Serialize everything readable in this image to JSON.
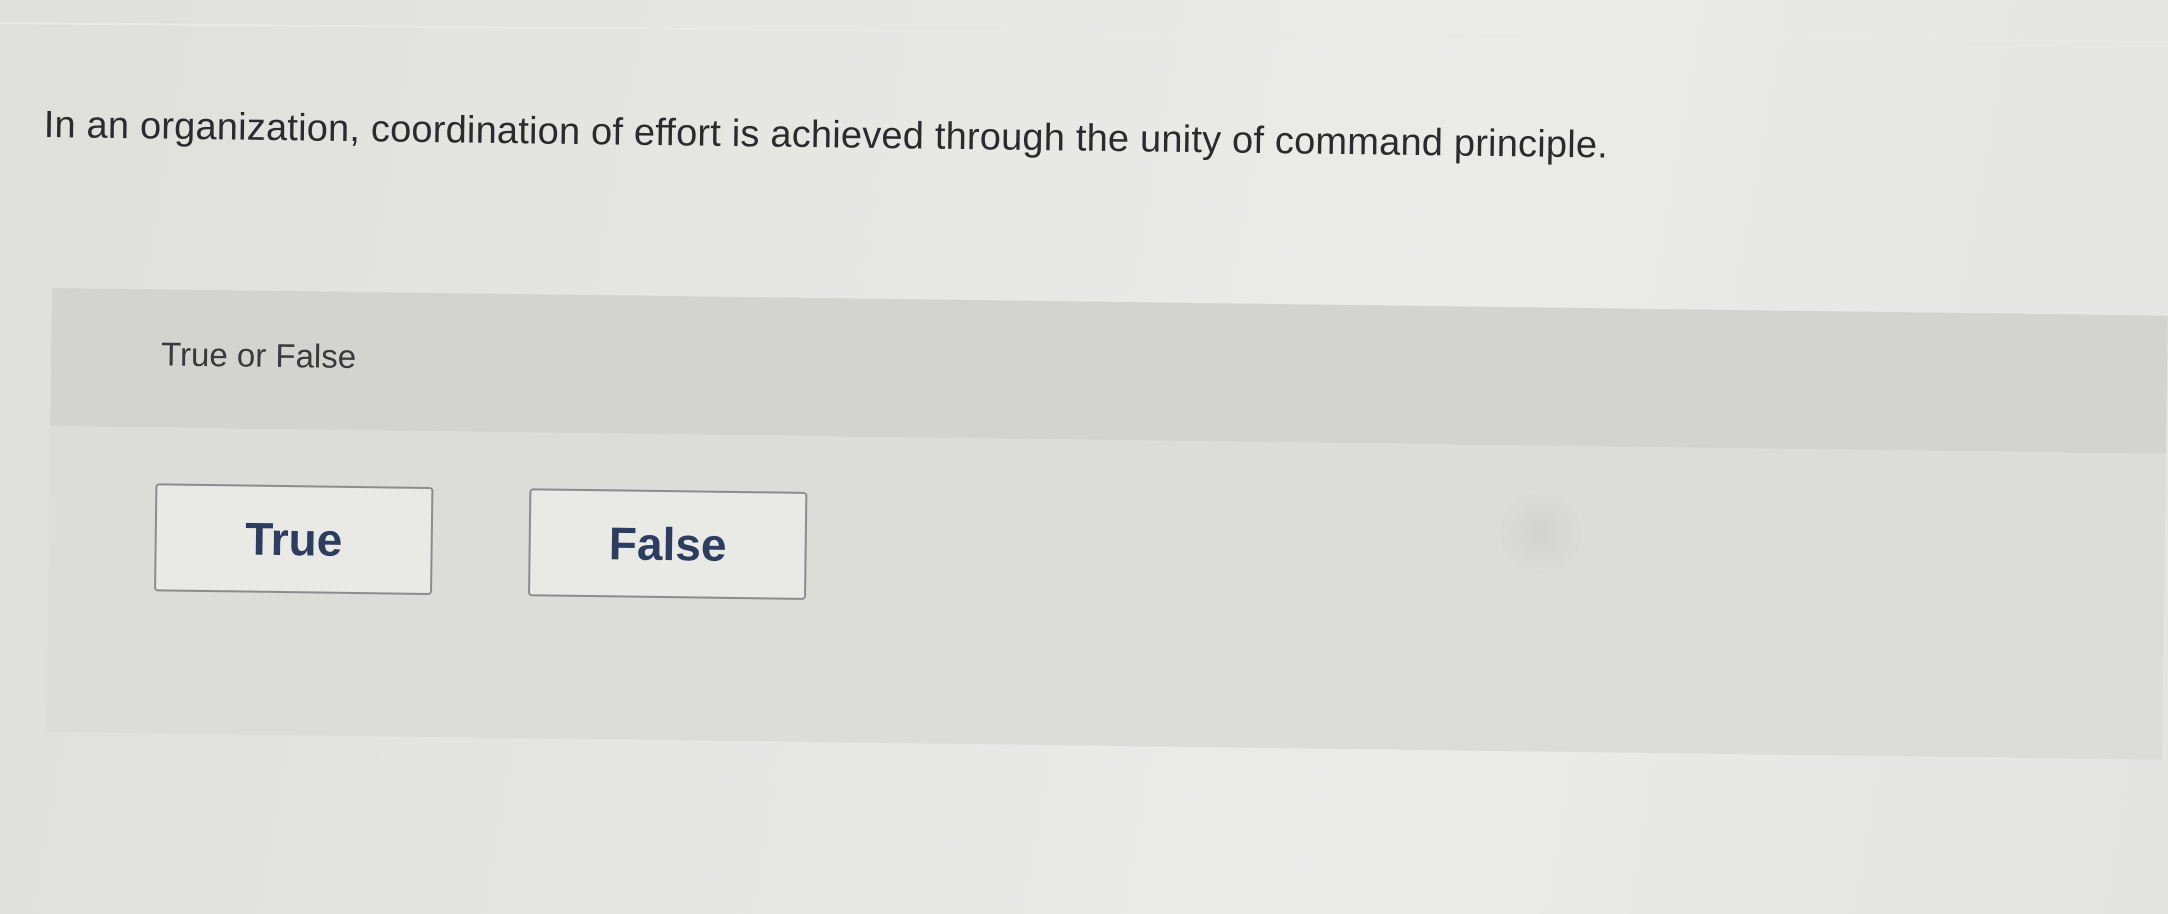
{
  "question": {
    "text": "In an organization, coordination of effort is achieved through the unity of command principle."
  },
  "answer_section": {
    "type_label": "True or False",
    "choices": [
      {
        "label": "True"
      },
      {
        "label": "False"
      }
    ]
  },
  "colors": {
    "page_background": "#e6e6e3",
    "panel_background": "#dcdcd9",
    "button_text": "#2c3d60",
    "button_border": "#8c8c8e"
  }
}
